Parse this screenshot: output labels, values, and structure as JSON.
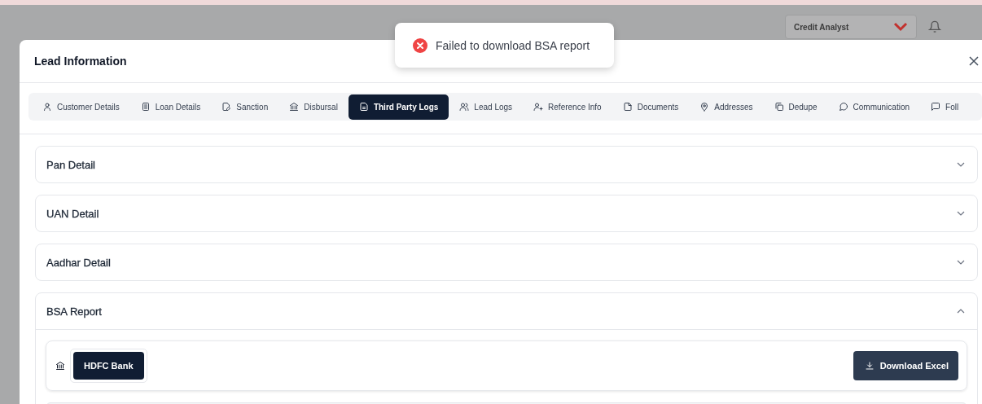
{
  "header": {
    "role_select": {
      "value": "Credit Analyst"
    }
  },
  "toast": {
    "kind": "error",
    "message": "Failed to download BSA report"
  },
  "modal": {
    "title": "Lead Information",
    "tabs": [
      {
        "label": "Customer Details",
        "selected": false
      },
      {
        "label": "Loan Details",
        "selected": false
      },
      {
        "label": "Sanction",
        "selected": false
      },
      {
        "label": "Disbursal",
        "selected": false
      },
      {
        "label": "Third Party Logs",
        "selected": true
      },
      {
        "label": "Lead Logs",
        "selected": false
      },
      {
        "label": "Reference Info",
        "selected": false
      },
      {
        "label": "Documents",
        "selected": false
      },
      {
        "label": "Addresses",
        "selected": false
      },
      {
        "label": "Dedupe",
        "selected": false
      },
      {
        "label": "Communication",
        "selected": false
      },
      {
        "label": "Foll",
        "selected": false
      }
    ],
    "sections": [
      {
        "title": "Pan Detail",
        "expanded": false
      },
      {
        "title": "UAN Detail",
        "expanded": false
      },
      {
        "title": "Aadhar Detail",
        "expanded": false
      },
      {
        "title": "BSA Report",
        "expanded": true,
        "banks": [
          {
            "label": "HDFC Bank",
            "selected": true
          }
        ],
        "action": "Download Excel"
      }
    ]
  }
}
